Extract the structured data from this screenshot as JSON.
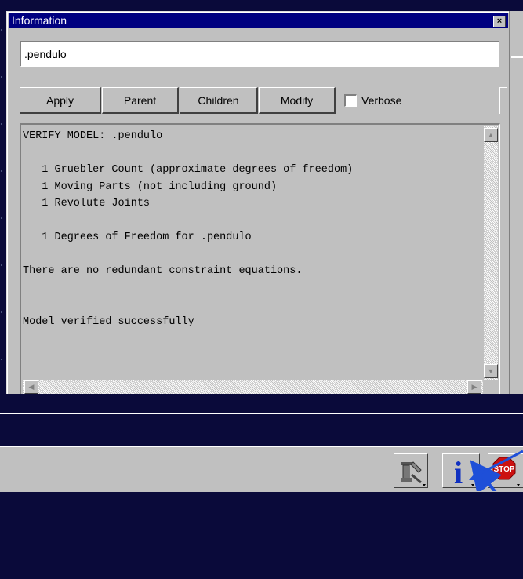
{
  "dialog": {
    "title": "Information",
    "close_glyph": "×",
    "name_field_value": ".pendulo",
    "buttons": {
      "apply": "Apply",
      "parent": "Parent",
      "children": "Children",
      "modify": "Modify"
    },
    "verbose_label": "Verbose",
    "verbose_checked": false,
    "output_lines": [
      "VERIFY MODEL: .pendulo",
      "",
      "   1 Gruebler Count (approximate degrees of freedom)",
      "   1 Moving Parts (not including ground)",
      "   1 Revolute Joints",
      "",
      "   1 Degrees of Freedom for .pendulo",
      "",
      "There are no redundant constraint equations.",
      "",
      "",
      "Model verified successfully"
    ]
  },
  "toolbar": {
    "tools": [
      {
        "icon": "tools-icon"
      },
      {
        "icon": "info-icon",
        "label": "i"
      },
      {
        "icon": "stop-icon",
        "label": "STOP"
      }
    ]
  },
  "colors": {
    "titlebar": "#000080",
    "workspace": "#0a0a3a",
    "panel": "#c0c0c0",
    "arrow": "#1e4fd8",
    "info_glyph": "#1030c0",
    "stop_red": "#cc1010"
  }
}
